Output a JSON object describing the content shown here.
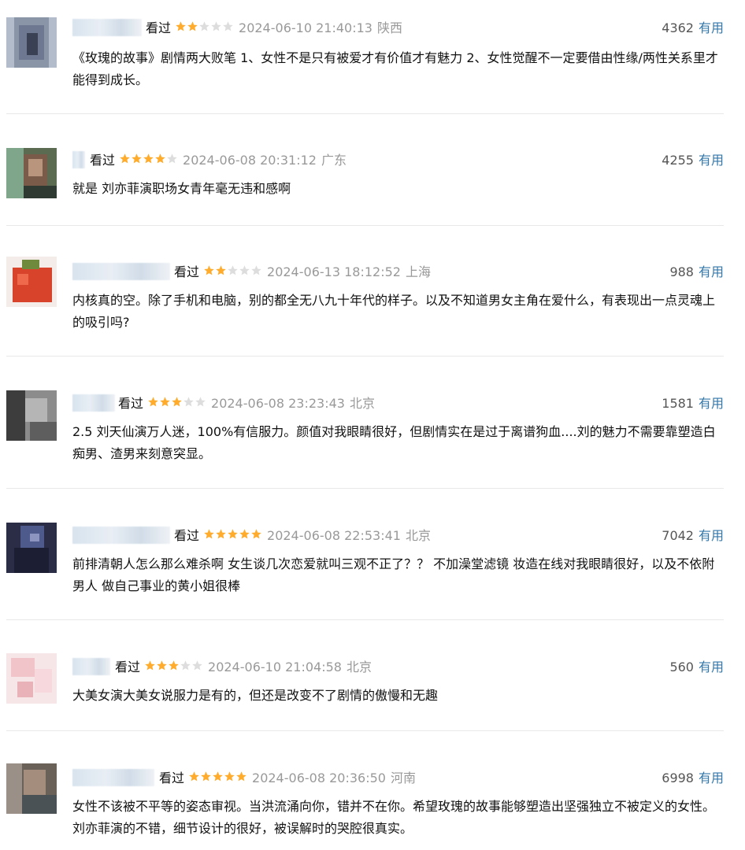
{
  "colors": {
    "star_on": "#ffac2d",
    "star_off": "#dddddd",
    "useful_link": "#3377aa",
    "meta_gray": "#999999"
  },
  "reviews": [
    {
      "status": "看过",
      "rating": 2,
      "time": "2024-06-10 21:40:13",
      "location": "陕西",
      "votes": "4362",
      "useful": "有用",
      "content": "《玫瑰的故事》剧情两大败笔 1、女性不是只有被爱才有价值才有魅力 2、女性觉醒不一定要借由性缘/两性关系里才能得到成长。"
    },
    {
      "status": "看过",
      "rating": 4,
      "time": "2024-06-08 20:31:12",
      "location": "广东",
      "votes": "4255",
      "useful": "有用",
      "content": "就是 刘亦菲演职场女青年毫无违和感啊"
    },
    {
      "status": "看过",
      "rating": 2,
      "time": "2024-06-13 18:12:52",
      "location": "上海",
      "votes": "988",
      "useful": "有用",
      "content": "内核真的空。除了手机和电脑，别的都全无八九十年代的样子。以及不知道男女主角在爱什么，有表现出一点灵魂上的吸引吗?"
    },
    {
      "status": "看过",
      "rating": 3,
      "time": "2024-06-08 23:23:43",
      "location": "北京",
      "votes": "1581",
      "useful": "有用",
      "content": "2.5 刘天仙演万人迷，100%有信服力。颜值对我眼睛很好，但剧情实在是过于离谱狗血....刘的魅力不需要靠塑造白痴男、渣男来刻意突显。"
    },
    {
      "status": "看过",
      "rating": 5,
      "time": "2024-06-08 22:53:41",
      "location": "北京",
      "votes": "7042",
      "useful": "有用",
      "content": "前排清朝人怎么那么难杀啊 女生谈几次恋爱就叫三观不正了？？ 不加澡堂滤镜 妆造在线对我眼睛很好，以及不依附男人 做自己事业的黄小姐很棒"
    },
    {
      "status": "看过",
      "rating": 3,
      "time": "2024-06-10 21:04:58",
      "location": "北京",
      "votes": "560",
      "useful": "有用",
      "content": "大美女演大美女说服力是有的，但还是改变不了剧情的傲慢和无趣"
    },
    {
      "status": "看过",
      "rating": 5,
      "time": "2024-06-08 20:36:50",
      "location": "河南",
      "votes": "6998",
      "useful": "有用",
      "content": "女性不该被不平等的姿态审视。当洪流涌向你，错并不在你。希望玫瑰的故事能够塑造出坚强独立不被定义的女性。刘亦菲演的不错，细节设计的很好，被误解时的哭腔很真实。"
    }
  ]
}
